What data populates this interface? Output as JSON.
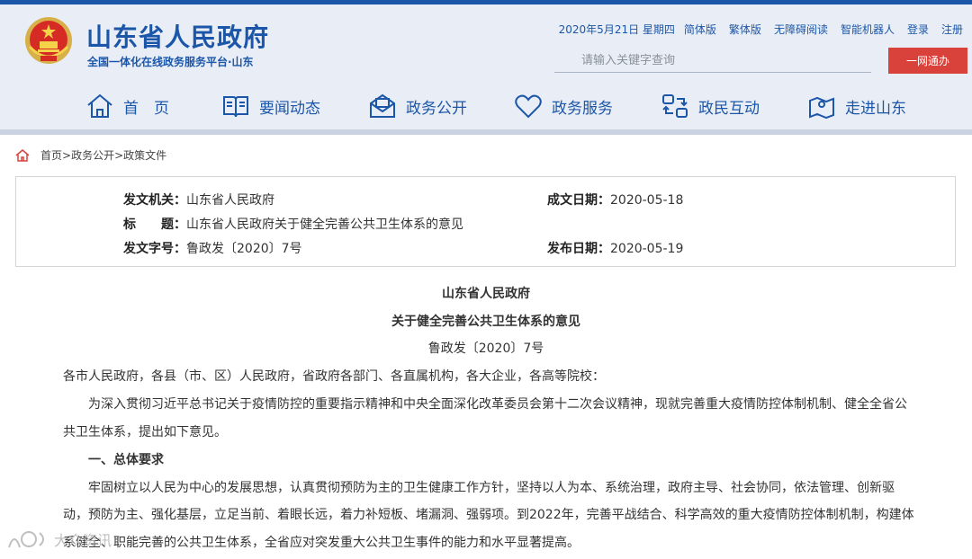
{
  "header": {
    "title": "山东省人民政府",
    "subtitle": "全国一体化在线政务服务平台·山东",
    "toplinks": {
      "date": "2020年5月21日 星期四",
      "simplified": "简体版",
      "traditional": "繁体版",
      "accessible": "无障碍阅读",
      "robot": "智能机器人",
      "login": "登录",
      "register": "注册"
    },
    "search_placeholder": "请输入关键字查询",
    "one_net_button": "一网通办"
  },
  "nav": [
    {
      "label": "首　页",
      "icon": "home-icon"
    },
    {
      "label": "要闻动态",
      "icon": "book-icon"
    },
    {
      "label": "政务公开",
      "icon": "mail-icon"
    },
    {
      "label": "政务服务",
      "icon": "heart-icon"
    },
    {
      "label": "政民互动",
      "icon": "interaction-icon"
    },
    {
      "label": "走进山东",
      "icon": "map-pin-icon"
    }
  ],
  "breadcrumb": {
    "home": "首页",
    "sep1": ">",
    "level2": "政务公开",
    "sep2": ">",
    "level3": "政策文件"
  },
  "info": {
    "issuer_label": "发文机关：",
    "issuer": "山东省人民政府",
    "date_label": "成文日期：",
    "date": "2020-05-18",
    "title_label": "标　　题：",
    "title": "山东省人民政府关于健全完善公共卫生体系的意见",
    "number_label": "发文字号：",
    "number": "鲁政发〔2020〕7号",
    "publish_label": "发布日期：",
    "publish": "2020-05-19"
  },
  "document": {
    "org": "山东省人民政府",
    "heading": "关于健全完善公共卫生体系的意见",
    "number": "鲁政发〔2020〕7号",
    "salutation": "各市人民政府，各县（市、区）人民政府，省政府各部门、各直属机构，各大企业，各高等院校：",
    "para1_line1": "为深入贯彻习近平总书记关于疫情防控的重要指示精神和中央全面深化改革委员会第十二次会议精神，现就完善重大疫情防控体制机制、健全全省公",
    "para1_line2": "共卫生体系，提出如下意见。",
    "section1": "一、总体要求",
    "para2_line1": "牢固树立以人民为中心的发展思想，认真贯彻预防为主的卫生健康工作方针，坚持以人为本、系统治理，政府主导、社会协同，依法管理、创新驱",
    "para2_line2": "动，预防为主、强化基层，立足当前、着眼长远，着力补短板、堵漏洞、强弱项。到2022年，完善平战结合、科学高效的重大疫情防控体制机制，构建体",
    "para2_line3": "系健全、职能完善的公共卫生体系，全省应对突发重大公共卫生事件的能力和水平显著提高。"
  },
  "watermark": "大众资讯",
  "colors": {
    "brand_blue": "#1c56a8",
    "accent_red": "#d9423a",
    "header_bg": "#e9eef6"
  }
}
